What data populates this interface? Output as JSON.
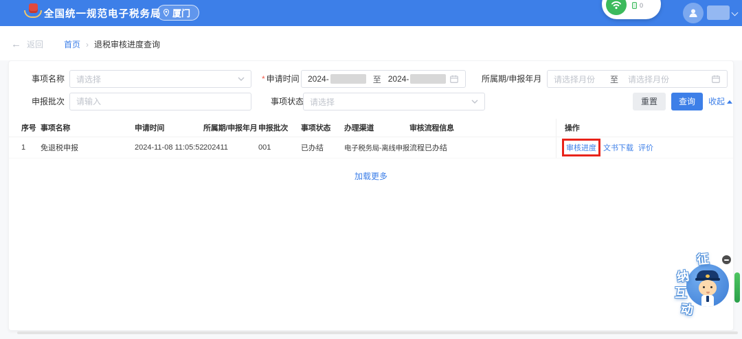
{
  "header": {
    "title": "全国统一规范电子税务局",
    "location": "厦门",
    "widget": {
      "count": "0"
    }
  },
  "breadcrumb": {
    "back": "返回",
    "home": "首页",
    "separator": "›",
    "current": "退税审核进度查询"
  },
  "filters": {
    "item_name": {
      "label": "事项名称",
      "placeholder": "请选择"
    },
    "apply_time": {
      "required_mark": "*",
      "label": "申请时间",
      "start_prefix": "2024-",
      "to": "至",
      "end_prefix": "2024-"
    },
    "period": {
      "label": "所属期/申报年月",
      "start_placeholder": "请选择月份",
      "to": "至",
      "end_placeholder": "请选择月份"
    },
    "batch": {
      "label": "申报批次",
      "placeholder": "请输入"
    },
    "status": {
      "label": "事项状态",
      "placeholder": "请选择"
    },
    "actions": {
      "reset": "重置",
      "query": "查询",
      "collapse": "收起"
    }
  },
  "table": {
    "columns": [
      "序号",
      "事项名称",
      "申请时间",
      "所属期/申报年月",
      "申报批次",
      "事项状态",
      "办理渠道",
      "审核流程信息",
      "操作"
    ],
    "rows": [
      {
        "seq": "1",
        "name": "免退税申报",
        "apply_time": "2024-11-08 11:05:52",
        "period": "202411",
        "batch": "001",
        "status": "已办结",
        "channel": "电子税务局-离线申报",
        "process_info": "流程已办结",
        "actions": {
          "review_progress": "审核进度",
          "document_download": "文书下载",
          "evaluate": "评价"
        }
      }
    ],
    "load_more": "加载更多"
  },
  "mascot": {
    "char_1": "征",
    "char_2": "纳",
    "char_3": "互",
    "char_4": "动"
  },
  "colors": {
    "header_blue": "#3d7fe8",
    "link_blue": "#3d7fe8",
    "annotation_red": "#e8231a",
    "wifi_green": "#3cba5c"
  }
}
